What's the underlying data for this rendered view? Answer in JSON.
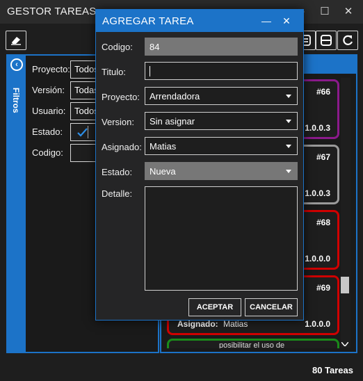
{
  "app": {
    "title": "GESTOR TAREAS",
    "minimize": "—",
    "maximize": "☐",
    "close": "✕"
  },
  "filters": {
    "tab_label": "Filtros",
    "rows": [
      {
        "label": "Proyecto:",
        "value": "Todos"
      },
      {
        "label": "Versión:",
        "value": "Todas"
      },
      {
        "label": "Usuario:",
        "value": "Todos"
      },
      {
        "label": "Estado:",
        "value": ""
      },
      {
        "label": "Codigo:",
        "value": ""
      }
    ]
  },
  "tasks": {
    "count_label": "80 Tareas",
    "cards": [
      {
        "id": "#66",
        "version": "1.0.0.3",
        "color": "#8b1a8b"
      },
      {
        "id": "#67",
        "version": "1.0.0.3",
        "color": "#9a9a9a"
      },
      {
        "id": "#68",
        "version": "1.0.0.0",
        "color": "#d00000"
      },
      {
        "id": "#69",
        "version": "1.0.0.0",
        "color": "#d00000",
        "assigned_label": "Asignado:",
        "assigned_value": "Matias"
      },
      {
        "partial_text": "posibilitar el uso de",
        "color": "#1a8a1a"
      }
    ]
  },
  "dialog": {
    "title": "AGREGAR TAREA",
    "minimize": "—",
    "close": "✕",
    "fields": {
      "codigo": {
        "label": "Codigo:",
        "value": "84"
      },
      "titulo": {
        "label": "Titulo:",
        "value": ""
      },
      "proyecto": {
        "label": "Proyecto:",
        "value": "Arrendadora"
      },
      "version": {
        "label": "Version:",
        "value": "Sin asignar"
      },
      "asignado": {
        "label": "Asignado:",
        "value": "Matias"
      },
      "estado": {
        "label": "Estado:",
        "value": "Nueva"
      },
      "detalle": {
        "label": "Detalle:",
        "value": ""
      }
    },
    "accept_label": "ACEPTAR",
    "cancel_label": "CANCELAR"
  },
  "colors": {
    "accent": "#1c73c8",
    "background": "#1e1e1e"
  }
}
